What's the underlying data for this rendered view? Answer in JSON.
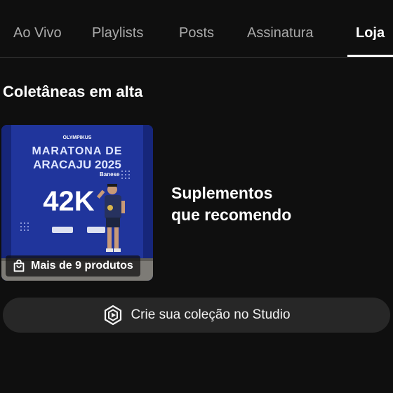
{
  "tabs": [
    {
      "label": "Ao Vivo"
    },
    {
      "label": "Playlists"
    },
    {
      "label": "Posts"
    },
    {
      "label": "Assinatura"
    },
    {
      "label": "Loja"
    }
  ],
  "active_tab": "Loja",
  "section": {
    "title": "Coletâneas em alta"
  },
  "collection": {
    "title_line1": "Suplementos",
    "title_line2": "que recomendo",
    "badge": "Mais de 9 produtos",
    "thumbnail_text": {
      "brand": "OLYMPIKUS",
      "event_line1": "MARATONA DE",
      "event_line2": "ARACAJU 2025",
      "sponsor": "Banese",
      "distance": "42K"
    }
  },
  "studio_button": {
    "label": "Crie sua coleção no Studio",
    "icon": "studio-hex-play-icon"
  },
  "colors": {
    "background": "#0f0f0f",
    "button": "#272727",
    "text": "#f1f1f1",
    "muted": "#aaaaaa",
    "banner_blue": "#1a2e8a"
  }
}
